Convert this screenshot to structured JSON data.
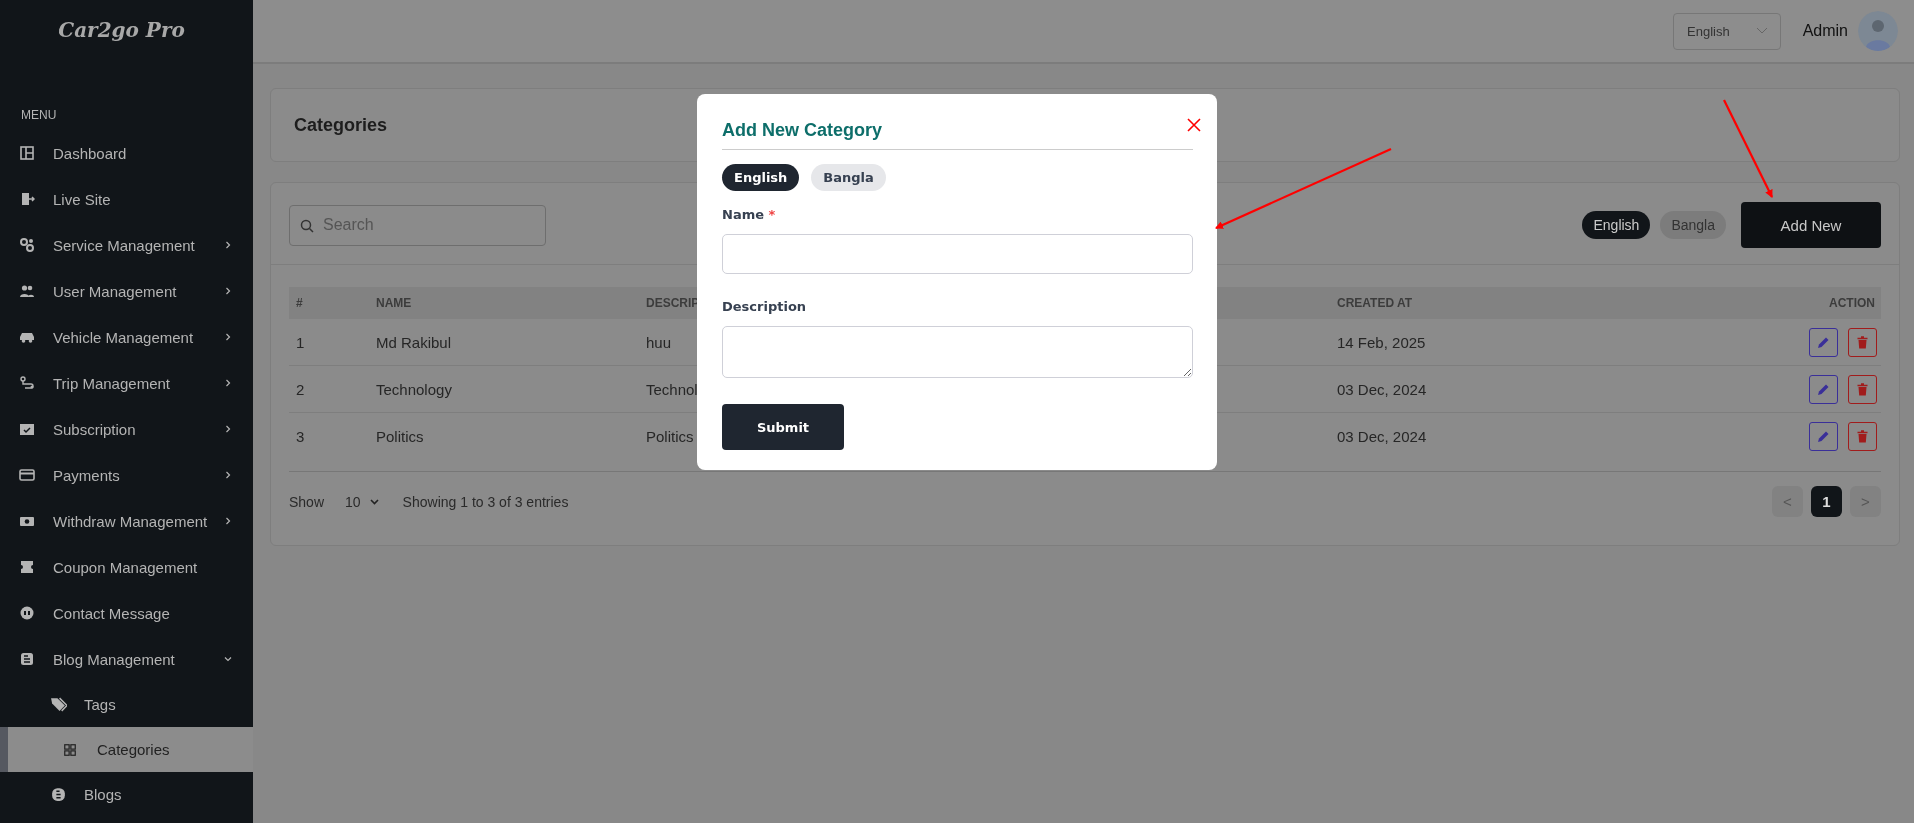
{
  "sidebar": {
    "logo": "Car2go Pro",
    "menu_label": "MENU",
    "items": [
      {
        "label": "Dashboard",
        "kind": "link"
      },
      {
        "label": "Live Site",
        "kind": "link"
      },
      {
        "label": "Service Management",
        "kind": "group",
        "expanded": false
      },
      {
        "label": "User Management",
        "kind": "group",
        "expanded": false
      },
      {
        "label": "Vehicle Management",
        "kind": "group",
        "expanded": false
      },
      {
        "label": "Trip Management",
        "kind": "group",
        "expanded": false
      },
      {
        "label": "Subscription",
        "kind": "group",
        "expanded": false
      },
      {
        "label": "Payments",
        "kind": "group",
        "expanded": false
      },
      {
        "label": "Withdraw Management",
        "kind": "group",
        "expanded": false
      },
      {
        "label": "Coupon Management",
        "kind": "link"
      },
      {
        "label": "Contact Message",
        "kind": "link"
      },
      {
        "label": "Blog Management",
        "kind": "group",
        "expanded": true,
        "children": [
          {
            "label": "Tags",
            "selected": false
          },
          {
            "label": "Categories",
            "selected": true
          },
          {
            "label": "Blogs",
            "selected": false
          }
        ]
      }
    ]
  },
  "header": {
    "language": "English",
    "user": "Admin"
  },
  "page_title": "Categories",
  "toolbar": {
    "search": {
      "placeholder": "Search"
    },
    "languages": [
      {
        "label": "English",
        "selected": true
      },
      {
        "label": "Bangla",
        "selected": false
      }
    ],
    "add_button": "Add New"
  },
  "table": {
    "columns": [
      "#",
      "NAME",
      "DESCRIP",
      "CREATED AT",
      "ACTION"
    ],
    "rows": [
      {
        "index": "1",
        "name": "Md Rakibul",
        "description": "huu",
        "created_at": "14 Feb, 2025"
      },
      {
        "index": "2",
        "name": "Technology",
        "description": "Technol",
        "created_at": "03 Dec, 2024"
      },
      {
        "index": "3",
        "name": "Politics",
        "description": "Politics",
        "created_at": "03 Dec, 2024"
      }
    ]
  },
  "footer": {
    "show_label": "Show",
    "page_size": "10",
    "summary": "Showing 1 to 3 of 3 entries",
    "pagination": {
      "prev": "<",
      "pages": [
        {
          "label": "1",
          "selected": true
        }
      ],
      "next": ">"
    }
  },
  "modal": {
    "title": "Add New Category",
    "languages": [
      {
        "label": "English",
        "selected": true
      },
      {
        "label": "Bangla",
        "selected": false
      }
    ],
    "fields": [
      {
        "label": "Name",
        "required_mark": "*",
        "kind": "input"
      },
      {
        "label": "Description",
        "kind": "textarea"
      }
    ],
    "submit": "Submit"
  }
}
